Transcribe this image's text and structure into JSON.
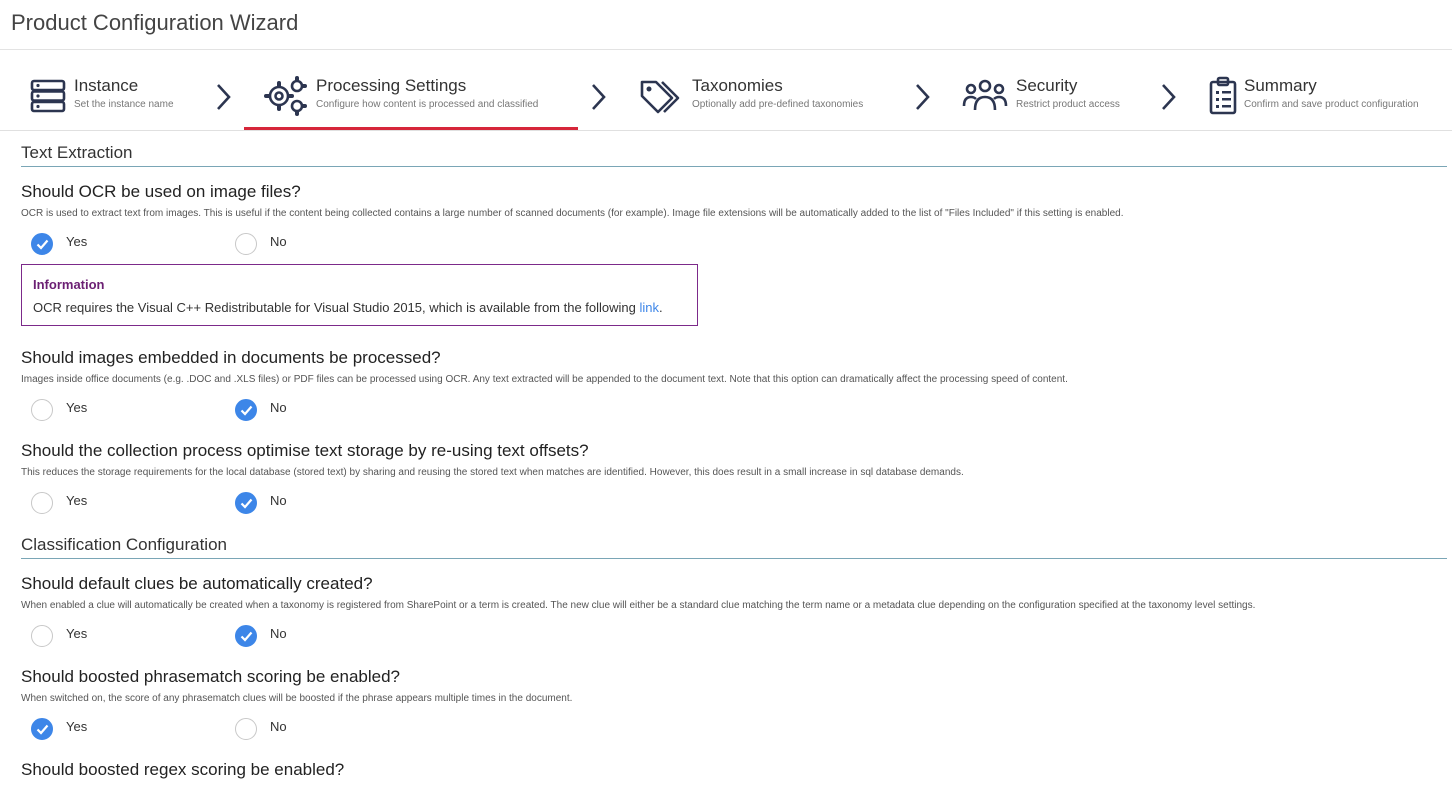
{
  "app": {
    "title": "Product Configuration Wizard"
  },
  "steps": [
    {
      "title": "Instance",
      "subtitle": "Set the instance name",
      "icon": "server-icon"
    },
    {
      "title": "Processing Settings",
      "subtitle": "Configure how content is processed and classified",
      "icon": "gears-icon"
    },
    {
      "title": "Taxonomies",
      "subtitle": "Optionally add pre-defined taxonomies",
      "icon": "tags-icon"
    },
    {
      "title": "Security",
      "subtitle": "Restrict product access",
      "icon": "users-icon"
    },
    {
      "title": "Summary",
      "subtitle": "Confirm and save product configuration",
      "icon": "clipboard-icon"
    }
  ],
  "active_step": "Processing Settings",
  "colors": {
    "accent": "#d6263a",
    "radio_selected": "#3d86e8",
    "info_border": "#7c2a8a",
    "section_rule": "#7aa6b6"
  },
  "sections": {
    "text_extraction": "Text Extraction",
    "classification": "Classification Configuration"
  },
  "options": {
    "yes": "Yes",
    "no": "No"
  },
  "questions": {
    "ocr": {
      "title": "Should OCR be used on image files?",
      "desc": "OCR is used to extract text from images. This is useful if the content being collected contains a large number of scanned documents (for example). Image file extensions will be automatically added to the list of \"Files Included\" if this setting is enabled.",
      "selected": "Yes"
    },
    "embedded": {
      "title": "Should images embedded in documents be processed?",
      "desc": "Images inside office documents (e.g. .DOC and .XLS files) or PDF files can be processed using OCR. Any text extracted will be appended to the document text. Note that this option can dramatically affect the processing speed of content.",
      "selected": "No"
    },
    "offsets": {
      "title": "Should the collection process optimise text storage by re-using text offsets?",
      "desc": "This reduces the storage requirements for the local database (stored text) by sharing and reusing the stored text when matches are identified. However, this does result in a small increase in sql database demands.",
      "selected": "No"
    },
    "clues": {
      "title": "Should default clues be automatically created?",
      "desc": "When enabled a clue will automatically be created when a taxonomy is registered from SharePoint or a term is created. The new clue will either be a standard clue matching the term name or a metadata clue depending on the configuration specified at the taxonomy level settings.",
      "selected": "No"
    },
    "phrasematch": {
      "title": "Should boosted phrasematch scoring be enabled?",
      "desc": "When switched on, the score of any phrasematch clues will be boosted if the phrase appears multiple times in the document.",
      "selected": "Yes"
    },
    "regex": {
      "title": "Should boosted regex scoring be enabled?"
    }
  },
  "info": {
    "title": "Information",
    "text": "OCR requires the Visual C++ Redistributable for Visual Studio 2015, which is available from the following ",
    "link": "link",
    "suffix": "."
  }
}
